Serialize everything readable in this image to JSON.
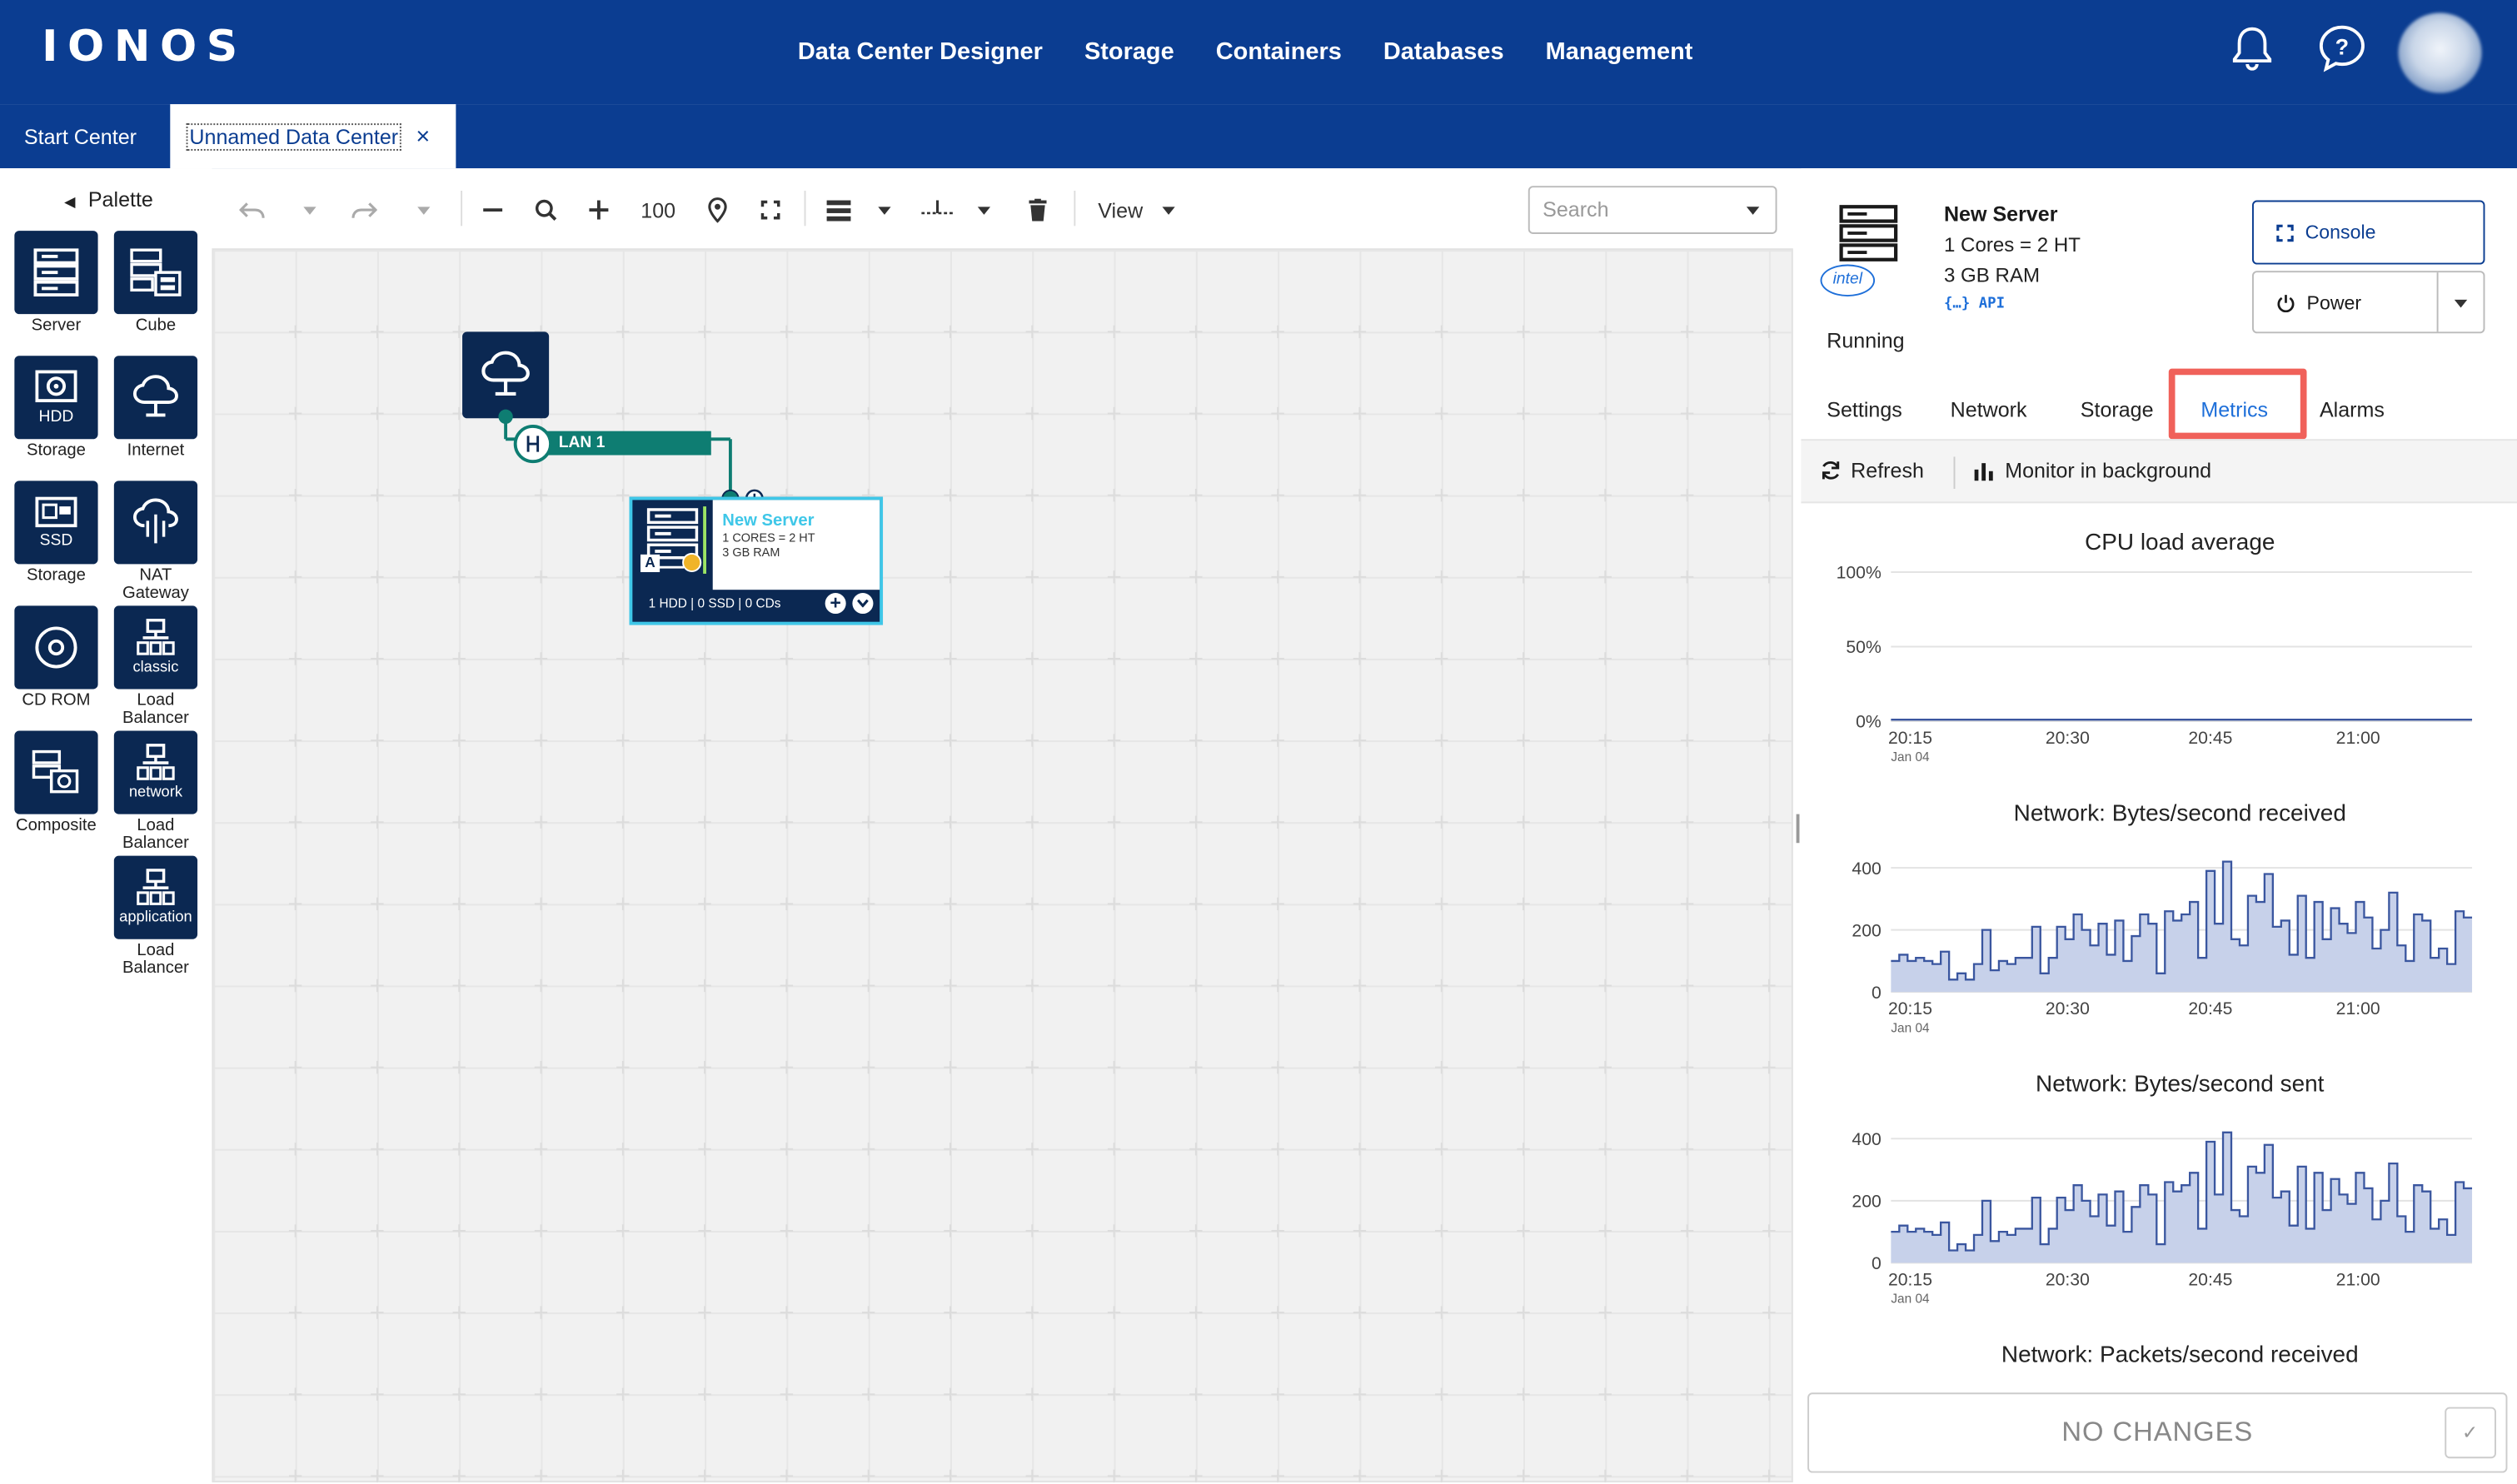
{
  "brand": {
    "logo": "IONOS"
  },
  "nav": [
    "Data Center Designer",
    "Storage",
    "Containers",
    "Databases",
    "Management"
  ],
  "tabs": {
    "start": "Start Center",
    "active": "Unnamed Data Center",
    "close": "×"
  },
  "palette": {
    "title": "Palette",
    "items": [
      {
        "label": "Server",
        "icon": "server-icon"
      },
      {
        "label": "Cube",
        "icon": "cube-icon"
      },
      {
        "label": "HDD\nStorage",
        "tag": "HDD",
        "caption": "Storage",
        "icon": "hdd-icon"
      },
      {
        "label": "Internet",
        "icon": "internet-icon"
      },
      {
        "tag": "SSD",
        "caption": "Storage",
        "icon": "ssd-icon"
      },
      {
        "caption": "NAT Gateway",
        "icon": "nat-gateway-icon"
      },
      {
        "caption": "CD ROM",
        "icon": "cdrom-icon"
      },
      {
        "tag": "classic",
        "caption": "Load Balancer",
        "icon": "load-balancer-icon"
      },
      {
        "caption": "Composite",
        "icon": "composite-icon"
      },
      {
        "tag": "network",
        "caption": "Load Balancer",
        "icon": "load-balancer-icon"
      },
      {
        "tag": "application",
        "caption": "Load Balancer",
        "icon": "load-balancer-icon"
      }
    ]
  },
  "toolbar": {
    "zoom": "100",
    "view": "View",
    "search_placeholder": "Search"
  },
  "canvas": {
    "lan_label": "LAN 1",
    "server_card": {
      "name": "New Server",
      "spec1": "1 CORES = 2 HT",
      "spec2": "3 GB RAM",
      "footer": "1 HDD | 0 SSD | 0 CDs",
      "badge": "A"
    }
  },
  "details": {
    "name": "New Server",
    "cores": "1 Cores = 2 HT",
    "ram": "3 GB RAM",
    "api": "{…} API",
    "cpu_vendor": "intel",
    "status": "Running",
    "console": "Console",
    "power": "Power",
    "tabs": [
      "Settings",
      "Network",
      "Storage",
      "Metrics",
      "Alarms"
    ],
    "active_tab": "Metrics",
    "refresh": "Refresh",
    "monitor": "Monitor in background",
    "no_changes": "NO CHANGES"
  },
  "chart_data": [
    {
      "type": "line",
      "title": "CPU load average",
      "yticks": [
        "100%",
        "50%",
        "0%"
      ],
      "ylim": [
        0,
        100
      ],
      "xticks": [
        "20:15",
        "20:30",
        "20:45",
        "21:00"
      ],
      "xsub": "Jan 04",
      "values": [
        1,
        1,
        1,
        1,
        1,
        1,
        1,
        1,
        1,
        1,
        1,
        1,
        1,
        1,
        1,
        1,
        1,
        1,
        1,
        1,
        1,
        1,
        1,
        1,
        1,
        1,
        1,
        1,
        1,
        1,
        1,
        1,
        1,
        1,
        1,
        1,
        1,
        1,
        1,
        1,
        1,
        1,
        1,
        1,
        1,
        1,
        1,
        1,
        1,
        1,
        1,
        1,
        1,
        1,
        1,
        1,
        1,
        1,
        1,
        1,
        1,
        1,
        1,
        1,
        1,
        1,
        1,
        1,
        1,
        1,
        1,
        1
      ]
    },
    {
      "type": "area",
      "title": "Network: Bytes/second received",
      "yticks": [
        "400",
        "200",
        "0"
      ],
      "ylim": [
        0,
        480
      ],
      "xticks": [
        "20:15",
        "20:30",
        "20:45",
        "21:00"
      ],
      "xsub": "Jan 04",
      "values": [
        100,
        120,
        100,
        110,
        100,
        90,
        130,
        40,
        60,
        40,
        90,
        200,
        70,
        100,
        90,
        110,
        110,
        210,
        60,
        110,
        210,
        170,
        250,
        200,
        150,
        220,
        120,
        230,
        100,
        180,
        250,
        220,
        60,
        260,
        230,
        250,
        290,
        110,
        390,
        220,
        420,
        170,
        150,
        310,
        290,
        380,
        210,
        230,
        120,
        310,
        110,
        290,
        170,
        270,
        220,
        190,
        290,
        240,
        140,
        200,
        320,
        150,
        100,
        250,
        230,
        110,
        140,
        90,
        260,
        240
      ]
    },
    {
      "type": "area",
      "title": "Network: Bytes/second sent",
      "yticks": [
        "400",
        "200",
        "0"
      ],
      "ylim": [
        0,
        480
      ],
      "xticks": [
        "20:15",
        "20:30",
        "20:45",
        "21:00"
      ],
      "xsub": "Jan 04",
      "values": [
        100,
        120,
        100,
        110,
        100,
        90,
        130,
        40,
        60,
        40,
        90,
        200,
        70,
        100,
        90,
        110,
        110,
        210,
        60,
        110,
        210,
        170,
        250,
        200,
        150,
        220,
        120,
        230,
        100,
        180,
        250,
        220,
        60,
        260,
        230,
        250,
        290,
        110,
        390,
        220,
        420,
        170,
        150,
        310,
        290,
        380,
        210,
        230,
        120,
        310,
        110,
        290,
        170,
        270,
        220,
        190,
        290,
        240,
        140,
        200,
        320,
        150,
        100,
        250,
        230,
        110,
        140,
        90,
        260,
        240
      ]
    },
    {
      "type": "area",
      "title": "Network: Packets/second received"
    }
  ],
  "colors": {
    "brand": "#0b3d91",
    "accent": "#1e6fd9",
    "lan": "#0e7d72",
    "highlight": "#f0615a",
    "area": "#c7d1ea",
    "areaLine": "#3a569f"
  }
}
